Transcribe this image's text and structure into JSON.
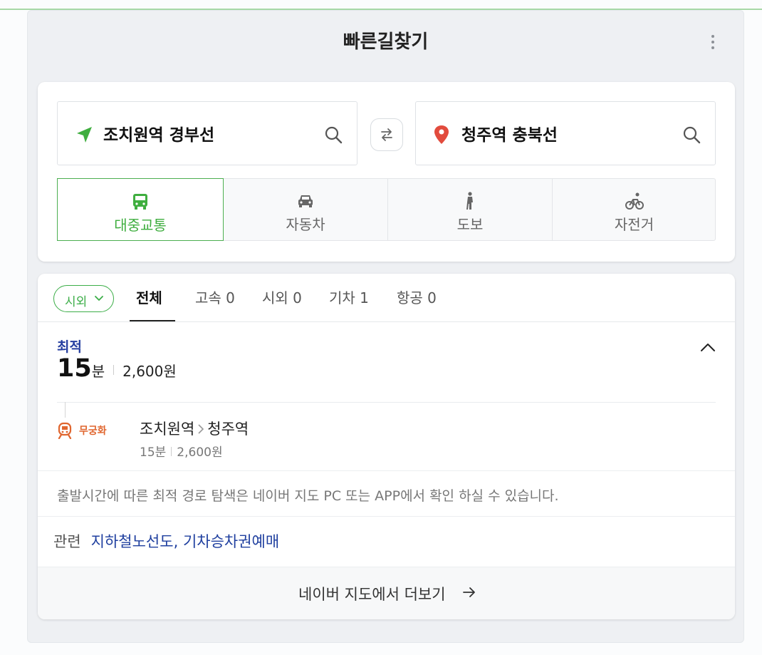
{
  "panel": {
    "title": "빠른길찾기"
  },
  "search": {
    "origin": "조치원역 경부선",
    "destination": "청주역 충북선"
  },
  "modes": [
    {
      "label": "대중교통",
      "icon": "bus-icon",
      "active": true
    },
    {
      "label": "자동차",
      "icon": "car-icon",
      "active": false
    },
    {
      "label": "도보",
      "icon": "walk-icon",
      "active": false
    },
    {
      "label": "자전거",
      "icon": "bike-icon",
      "active": false
    }
  ],
  "results": {
    "filter": "시외",
    "tabs": [
      {
        "label": "전체",
        "count": ""
      },
      {
        "label": "고속",
        "count": "0"
      },
      {
        "label": "시외",
        "count": "0"
      },
      {
        "label": "기차",
        "count": "1"
      },
      {
        "label": "항공",
        "count": "0"
      }
    ],
    "best": {
      "label": "최적",
      "time_num": "15",
      "time_unit": "분",
      "fare": "2,600원"
    },
    "route": {
      "train_type": "무궁화",
      "from": "조치원역",
      "to": "청주역",
      "duration": "15분",
      "fare": "2,600원"
    },
    "notice": "출발시간에 따른 최적 경로 탐색은 네이버 지도 PC 또는 APP에서 확인 하실 수 있습니다.",
    "related": {
      "label": "관련",
      "links": [
        "지하철노선도",
        "기차승차권예매"
      ],
      "separator": ","
    },
    "more_label": "네이버 지도에서 더보기"
  },
  "colors": {
    "accent_green": "#3cae48",
    "link_blue": "#1f3f9f",
    "origin_pin": "#3fae3f",
    "destination_pin": "#e24b3d",
    "train_orange": "#e0662f"
  }
}
